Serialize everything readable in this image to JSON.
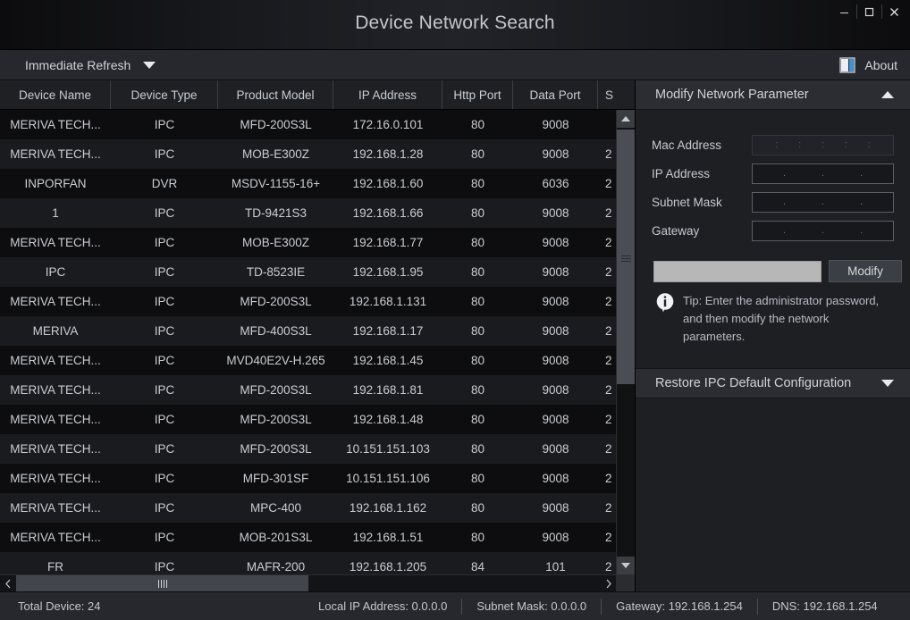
{
  "window": {
    "title": "Device Network Search",
    "buttons": [
      {
        "name": "minimize",
        "glyph": "–"
      },
      {
        "name": "maximize",
        "glyph": "□"
      },
      {
        "name": "close",
        "glyph": "✕"
      }
    ]
  },
  "toolbar": {
    "refresh_label": "Immediate Refresh",
    "refresh_caret": "chevron-down-icon",
    "about_label": "About",
    "about_icon": "about-book-icon"
  },
  "table": {
    "columns": [
      "Device Name",
      "Device Type",
      "Product Model",
      "IP Address",
      "Http Port",
      "Data Port",
      "S"
    ],
    "rows": [
      {
        "device_name": "MERIVA TECH...",
        "device_type": "IPC",
        "product_model": "MFD-200S3L",
        "ip_address": "172.16.0.101",
        "http_port": "80",
        "data_port": "9008",
        "subnet": ""
      },
      {
        "device_name": "MERIVA TECH...",
        "device_type": "IPC",
        "product_model": "MOB-E300Z",
        "ip_address": "192.168.1.28",
        "http_port": "80",
        "data_port": "9008",
        "subnet": "2"
      },
      {
        "device_name": "INPORFAN",
        "device_type": "DVR",
        "product_model": "MSDV-1155-16+",
        "ip_address": "192.168.1.60",
        "http_port": "80",
        "data_port": "6036",
        "subnet": "2"
      },
      {
        "device_name": "1",
        "device_type": "IPC",
        "product_model": "TD-9421S3",
        "ip_address": "192.168.1.66",
        "http_port": "80",
        "data_port": "9008",
        "subnet": "2"
      },
      {
        "device_name": "MERIVA TECH...",
        "device_type": "IPC",
        "product_model": "MOB-E300Z",
        "ip_address": "192.168.1.77",
        "http_port": "80",
        "data_port": "9008",
        "subnet": "2"
      },
      {
        "device_name": "IPC",
        "device_type": "IPC",
        "product_model": "TD-8523IE",
        "ip_address": "192.168.1.95",
        "http_port": "80",
        "data_port": "9008",
        "subnet": "2"
      },
      {
        "device_name": "MERIVA TECH...",
        "device_type": "IPC",
        "product_model": "MFD-200S3L",
        "ip_address": "192.168.1.131",
        "http_port": "80",
        "data_port": "9008",
        "subnet": "2"
      },
      {
        "device_name": "MERIVA",
        "device_type": "IPC",
        "product_model": "MFD-400S3L",
        "ip_address": "192.168.1.17",
        "http_port": "80",
        "data_port": "9008",
        "subnet": "2"
      },
      {
        "device_name": "MERIVA TECH...",
        "device_type": "IPC",
        "product_model": "MVD40E2V-H.265",
        "ip_address": "192.168.1.45",
        "http_port": "80",
        "data_port": "9008",
        "subnet": "2"
      },
      {
        "device_name": "MERIVA TECH...",
        "device_type": "IPC",
        "product_model": "MFD-200S3L",
        "ip_address": "192.168.1.81",
        "http_port": "80",
        "data_port": "9008",
        "subnet": "2"
      },
      {
        "device_name": "MERIVA TECH...",
        "device_type": "IPC",
        "product_model": "MFD-200S3L",
        "ip_address": "192.168.1.48",
        "http_port": "80",
        "data_port": "9008",
        "subnet": "2"
      },
      {
        "device_name": "MERIVA TECH...",
        "device_type": "IPC",
        "product_model": "MFD-200S3L",
        "ip_address": "10.151.151.103",
        "http_port": "80",
        "data_port": "9008",
        "subnet": "2"
      },
      {
        "device_name": "MERIVA TECH...",
        "device_type": "IPC",
        "product_model": "MFD-301SF",
        "ip_address": "10.151.151.106",
        "http_port": "80",
        "data_port": "9008",
        "subnet": "2"
      },
      {
        "device_name": "MERIVA TECH...",
        "device_type": "IPC",
        "product_model": "MPC-400",
        "ip_address": "192.168.1.162",
        "http_port": "80",
        "data_port": "9008",
        "subnet": "2"
      },
      {
        "device_name": "MERIVA TECH...",
        "device_type": "IPC",
        "product_model": "MOB-201S3L",
        "ip_address": "192.168.1.51",
        "http_port": "80",
        "data_port": "9008",
        "subnet": "2"
      },
      {
        "device_name": "FR",
        "device_type": "IPC",
        "product_model": "MAFR-200",
        "ip_address": "192.168.1.205",
        "http_port": "84",
        "data_port": "101",
        "subnet": "2"
      }
    ]
  },
  "panel": {
    "modify": {
      "title": "Modify Network Parameter",
      "collapse_icon": "chevron-up-icon",
      "fields": [
        {
          "label": "Mac Address",
          "value": "",
          "separator": ":",
          "segments": 6,
          "disabled": true
        },
        {
          "label": "IP Address",
          "value": "",
          "separator": ".",
          "segments": 4,
          "disabled": false
        },
        {
          "label": "Subnet Mask",
          "value": "",
          "separator": ".",
          "segments": 4,
          "disabled": false
        },
        {
          "label": "Gateway",
          "value": "",
          "separator": ".",
          "segments": 4,
          "disabled": false
        }
      ],
      "password_value": "",
      "password_placeholder": "",
      "modify_button": "Modify",
      "tip_icon": "info-icon",
      "tip_text": "Tip: Enter the administrator password, and then modify the network parameters."
    },
    "restore": {
      "title": "Restore IPC Default Configuration",
      "expand_icon": "chevron-down-icon"
    }
  },
  "statusbar": {
    "total_device": "Total Device: 24",
    "local_ip": "Local IP Address: 0.0.0.0",
    "subnet_mask": "Subnet Mask: 0.0.0.0",
    "gateway": "Gateway: 192.168.1.254",
    "dns": "DNS: 192.168.1.254"
  },
  "colors": {
    "window_bg": "#0b0b0d",
    "toolbar_bg": "#26282d",
    "panel_bg": "#1d1f23",
    "row_odd": "#0d0d10",
    "row_even": "#1a1b1f",
    "accent_blue": "#3c93d6",
    "text": "#c9cdd2"
  }
}
